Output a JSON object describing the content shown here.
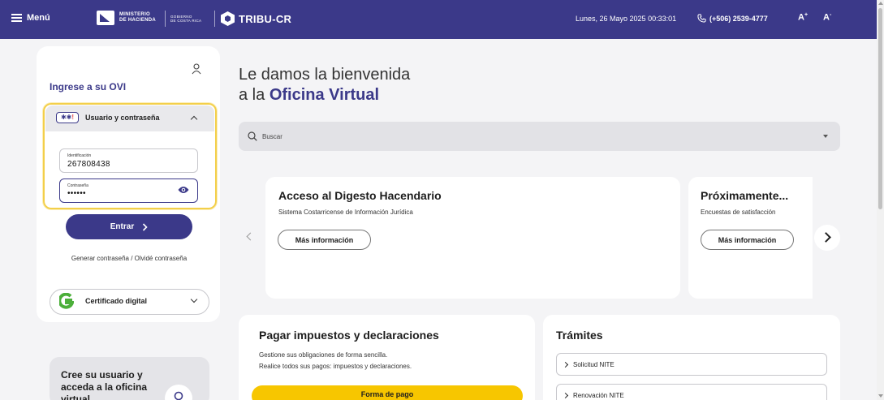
{
  "header": {
    "menu_label": "Menú",
    "ministry_line1": "MINISTERIO",
    "ministry_line2": "DE HACIENDA",
    "gov_line1": "GOBIERNO",
    "gov_line2": "DE COSTA RICA",
    "app_name": "TRIBU-CR",
    "date_text": "Lunes, 26 Mayo 2025 00:33:01",
    "phone_text": "(+506) 2539-4777",
    "font_increase": "A",
    "font_increase_sup": "+",
    "font_decrease": "A",
    "font_decrease_sup": "-",
    "bar_color": "#3b3989"
  },
  "login": {
    "title": "Ingrese a su OVI",
    "accordion_label": "Usuario y contraseña",
    "key_badge": "✱✱",
    "key_badge_alert": "!",
    "id_label": "Identificación",
    "id_value": "267808438",
    "password_label": "Contraseña",
    "password_value": "••••••",
    "enter_label": "Entrar",
    "password_links": "Generar contraseña / Olvidé contraseña",
    "certificate_label": "Certificado digital",
    "create_text": "Cree su usuario y acceda a la oficina virtual"
  },
  "welcome": {
    "line1": "Le damos la bienvenida",
    "line2_prefix": "a la ",
    "line2_bold": "Oficina Virtual"
  },
  "search": {
    "placeholder": "Buscar"
  },
  "carousel": {
    "slides": [
      {
        "title": "Acceso al Digesto Hacendario",
        "subtitle": "Sistema Costarricense de Información Jurídica",
        "button": "Más información"
      },
      {
        "title": "Próximamente...",
        "subtitle": "Encuestas de satisfacción",
        "button": "Más información"
      }
    ]
  },
  "payments": {
    "title": "Pagar impuestos y declaraciones",
    "desc_line1": "Gestione sus obligaciones de forma sencilla.",
    "desc_line2": "Realice todos sus pagos: impuestos y declaraciones.",
    "button": "Forma de pago",
    "accent": "#f7c600"
  },
  "procedures": {
    "title": "Trámites",
    "items": [
      "Solicitud NITE",
      "Renovación NITE"
    ]
  }
}
